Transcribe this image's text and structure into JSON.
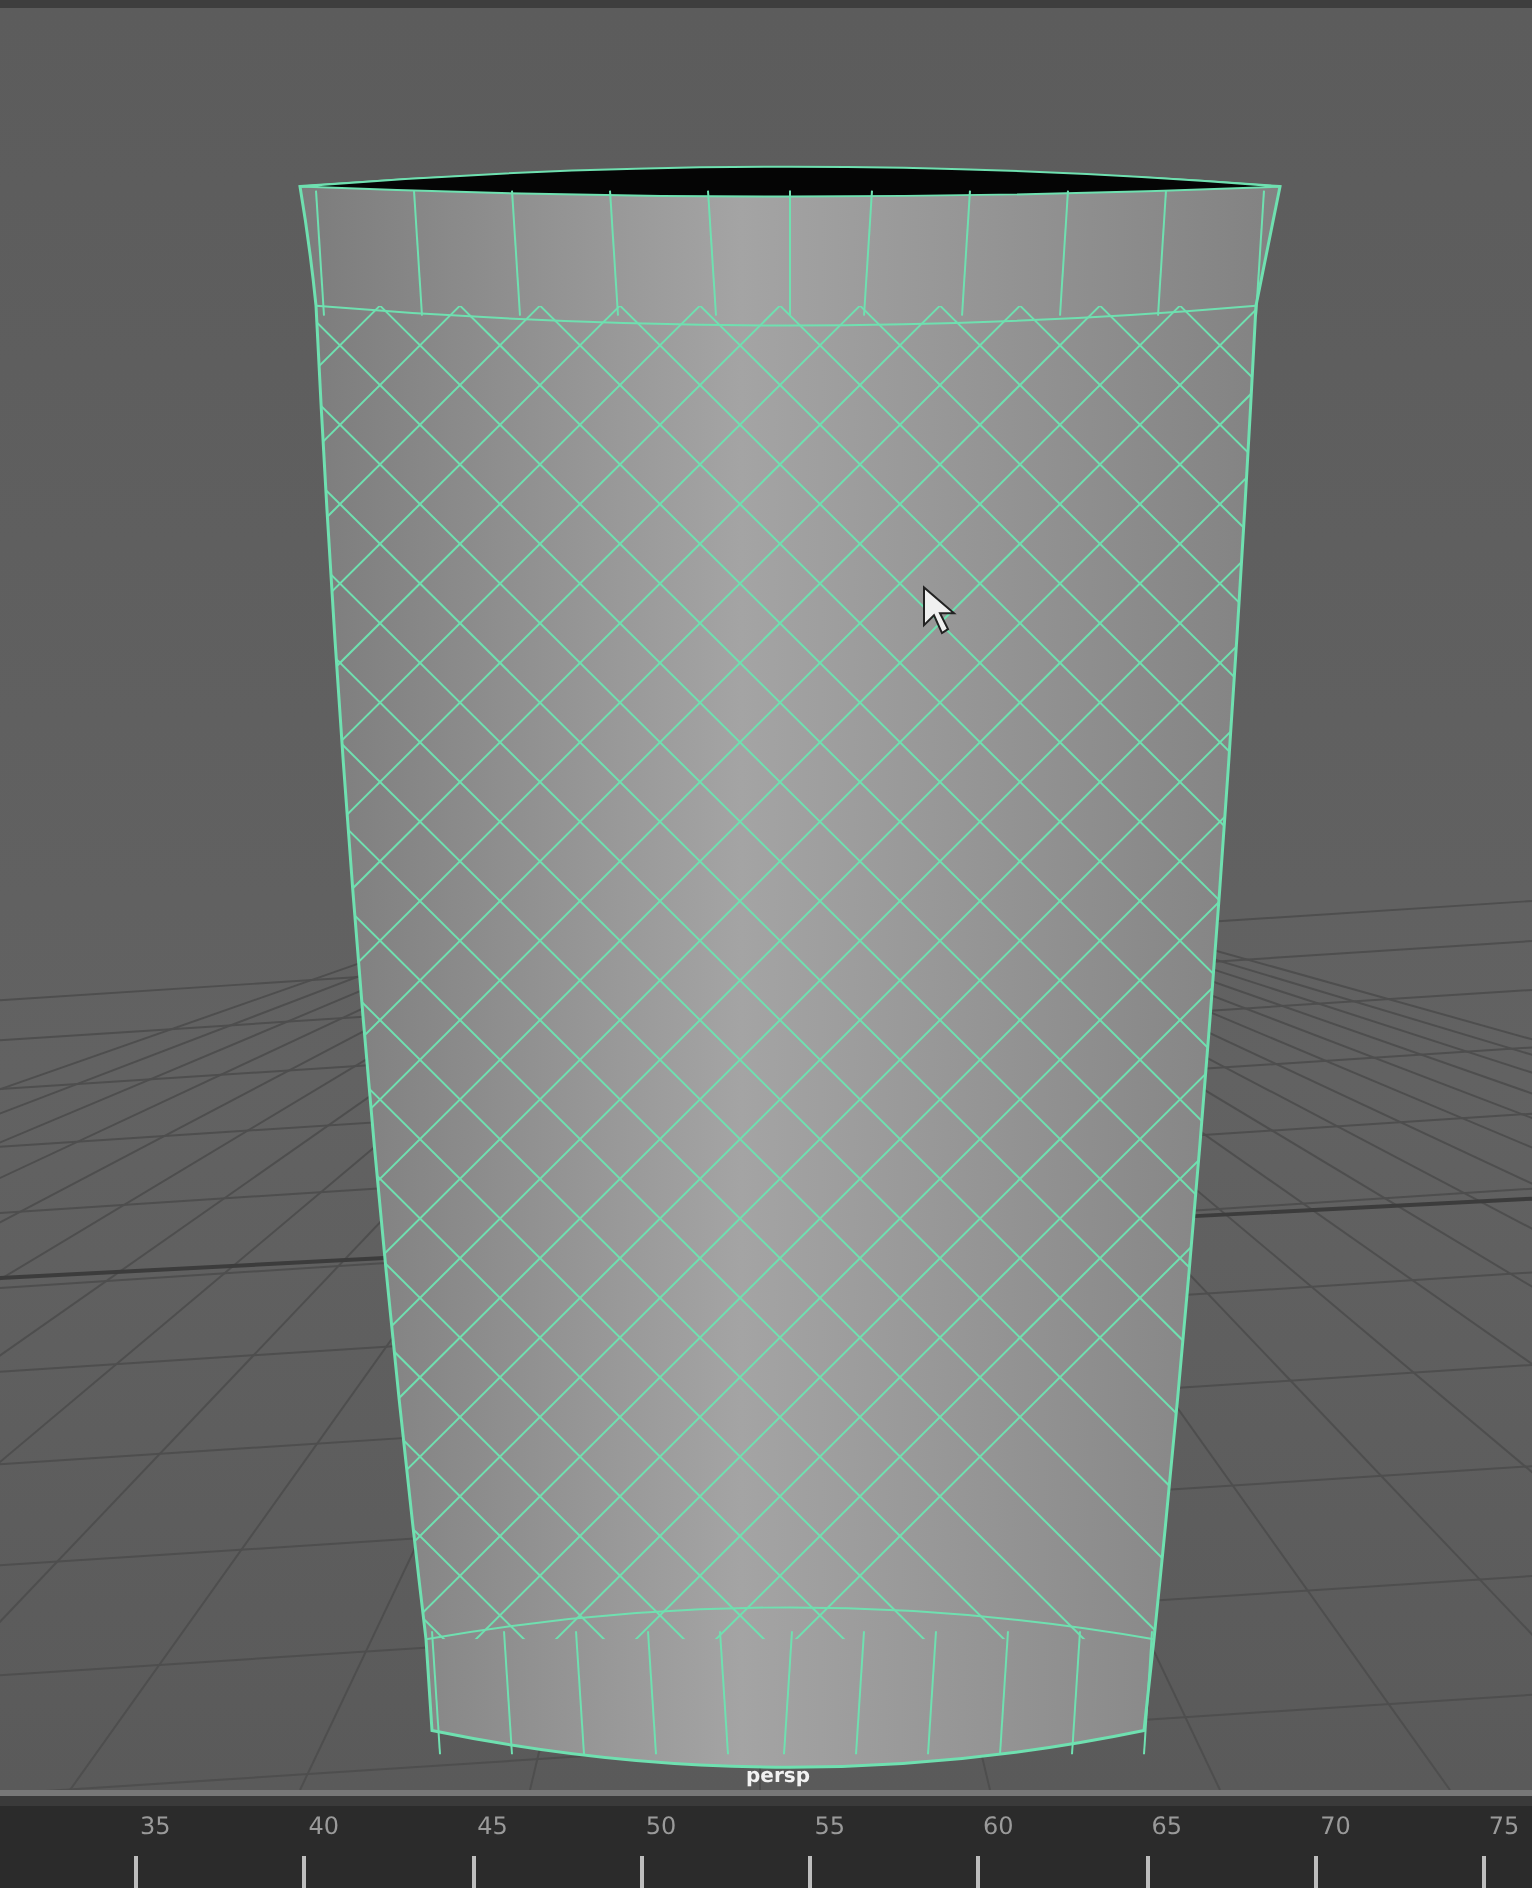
{
  "viewport": {
    "camera_label": "persp"
  },
  "timeline": {
    "frames": [
      "35",
      "40",
      "45",
      "50",
      "55",
      "60",
      "65",
      "70",
      "75"
    ]
  }
}
